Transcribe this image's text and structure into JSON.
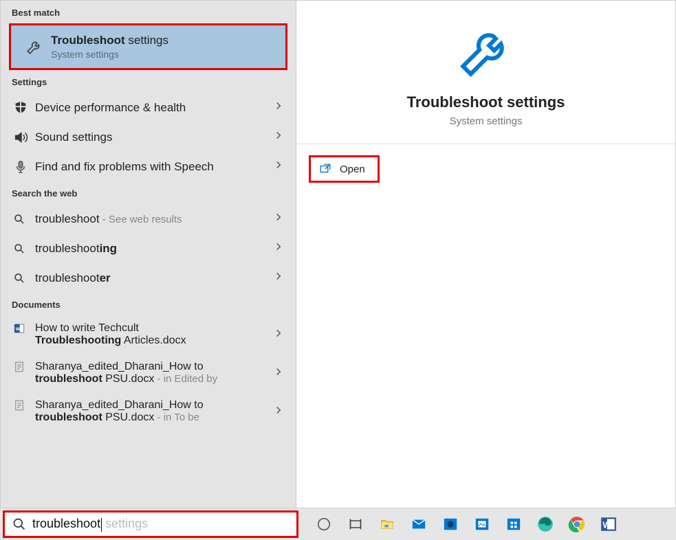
{
  "sections": {
    "best_match": "Best match",
    "settings": "Settings",
    "search_web": "Search the web",
    "documents": "Documents"
  },
  "best_match_item": {
    "title_prefix": "Troubleshoot",
    "title_suffix": " settings",
    "subtitle": "System settings"
  },
  "settings_items": [
    {
      "label": "Device performance & health"
    },
    {
      "label": "Sound settings"
    },
    {
      "label": "Find and fix problems with Speech"
    }
  ],
  "web_items": [
    {
      "prefix": "troubleshoot",
      "bold": "",
      "suffix": " - See web results"
    },
    {
      "prefix": "troubleshoot",
      "bold": "ing",
      "suffix": ""
    },
    {
      "prefix": "troubleshoot",
      "bold": "er",
      "suffix": ""
    }
  ],
  "docs": [
    {
      "line1_a": "How to write Techcult ",
      "line2_bold": "Troubleshooting",
      "line2_rest": " Articles.docx",
      "loc": ""
    },
    {
      "line1_a": "Sharanya_edited_Dharani_How to ",
      "line2_bold": "troubleshoot",
      "line2_rest": " PSU.docx",
      "loc": " - in Edited by"
    },
    {
      "line1_a": "Sharanya_edited_Dharani_How to ",
      "line2_bold": "troubleshoot",
      "line2_rest": " PSU.docx",
      "loc": " - in To be"
    }
  ],
  "preview": {
    "title": "Troubleshoot settings",
    "subtitle": "System settings",
    "open_label": "Open"
  },
  "search": {
    "typed": "troubleshoot",
    "ghost": " settings"
  },
  "colors": {
    "accent_blue": "#0078d4",
    "highlight_bg": "#a8c6df",
    "annotation_red": "#e60000"
  }
}
